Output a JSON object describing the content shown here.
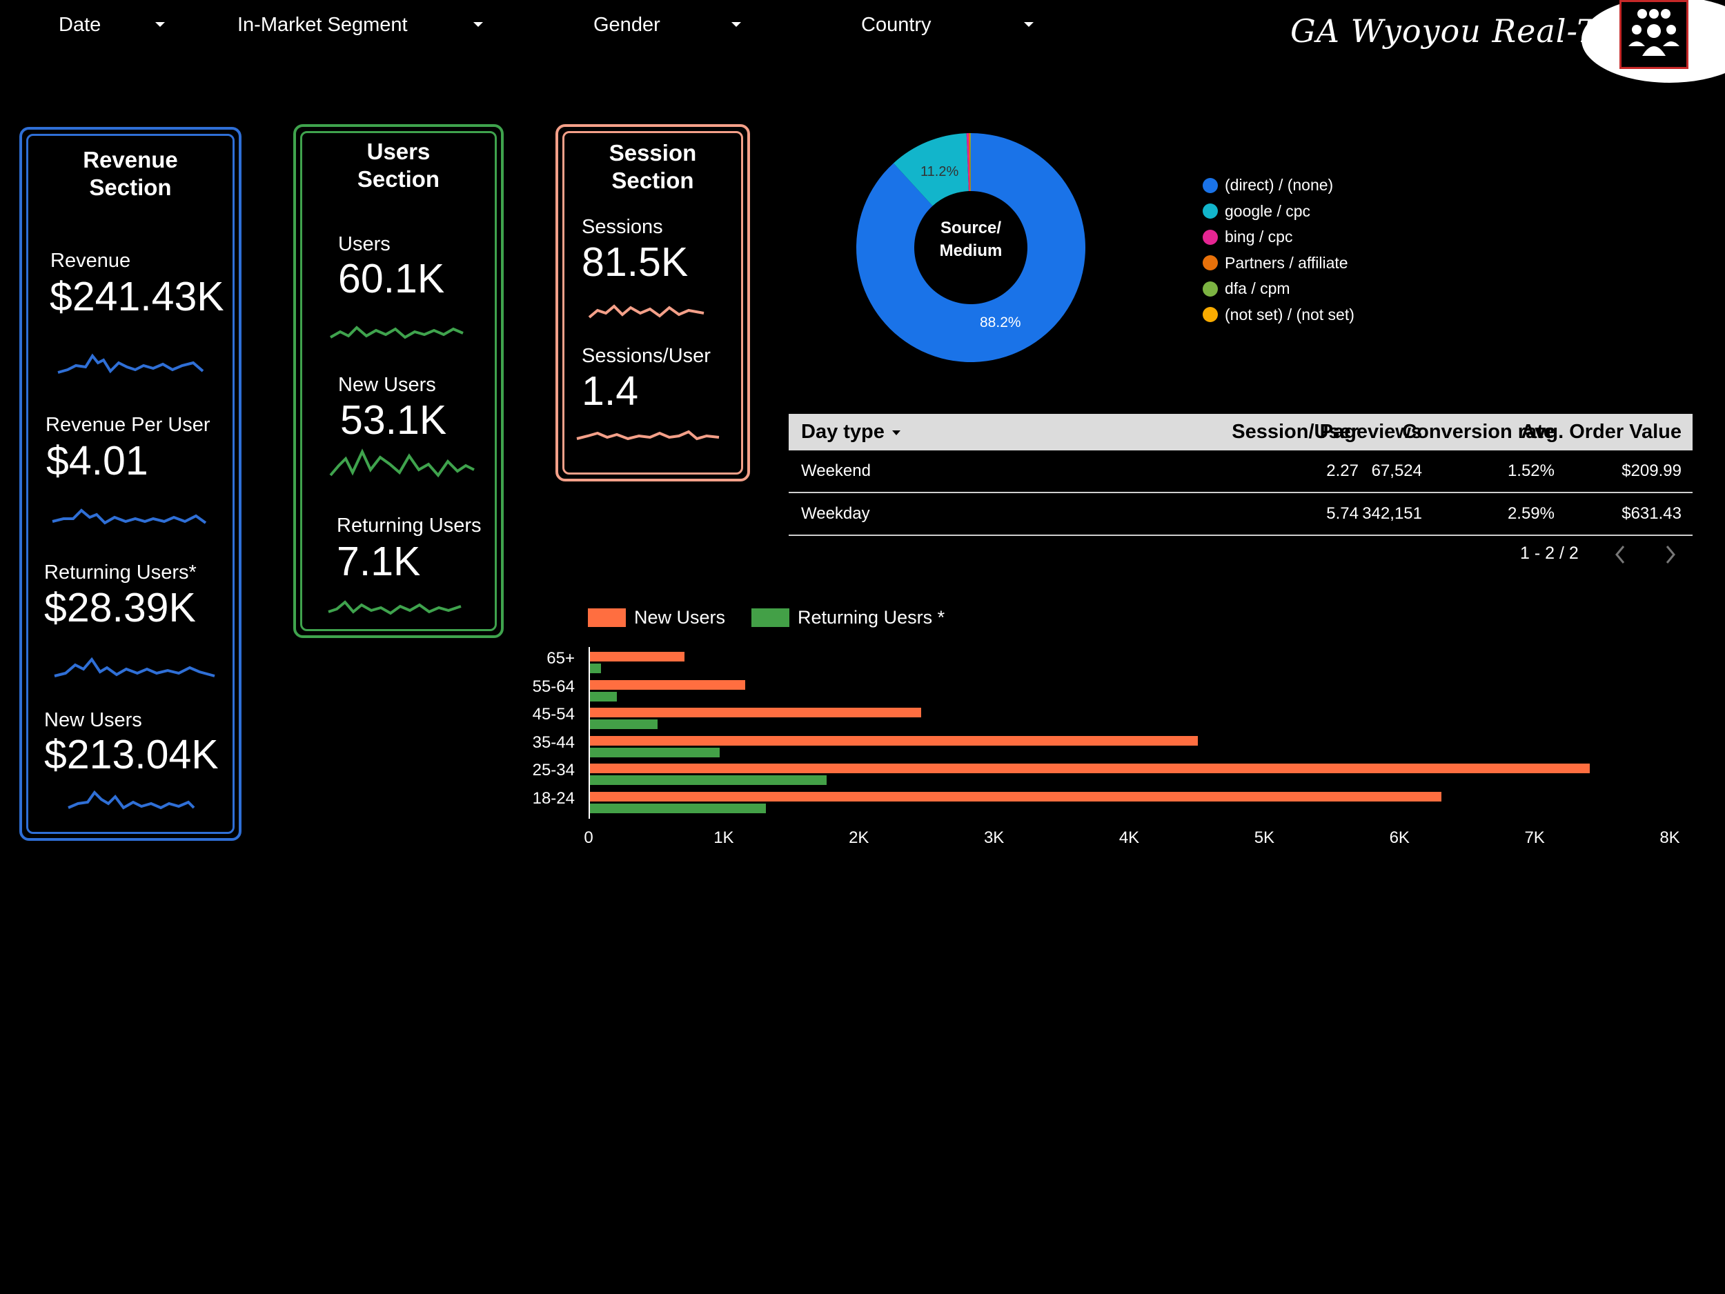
{
  "filters": [
    {
      "label": "Date"
    },
    {
      "label": "In-Market Segment"
    },
    {
      "label": "Gender"
    },
    {
      "label": "Country"
    }
  ],
  "header": {
    "title": "GA Wyoyou Real-Time",
    "logo_icon": "people-group-icon"
  },
  "revenue": {
    "title_line1": "Revenue",
    "title_line2": "Section",
    "color": "#2f6fd6",
    "metrics": [
      {
        "label": "Revenue",
        "value": "$241.43K"
      },
      {
        "label": "Revenue Per User",
        "value": "$4.01"
      },
      {
        "label": "Returning Users*",
        "value": "$28.39K"
      },
      {
        "label": "New Users",
        "value": "$213.04K"
      }
    ]
  },
  "users": {
    "title_line1": "Users",
    "title_line2": "Section",
    "color": "#3fa34d",
    "metrics": [
      {
        "label": "Users",
        "value": "60.1K"
      },
      {
        "label": "New Users",
        "value": "53.1K"
      },
      {
        "label": "Returning Users",
        "value": "7.1K"
      }
    ]
  },
  "sessions": {
    "title_line1": "Session",
    "title_line2": "Section",
    "color": "#f4a089",
    "metrics": [
      {
        "label": "Sessions",
        "value": "81.5K"
      },
      {
        "label": "Sessions/User",
        "value": "1.4"
      }
    ]
  },
  "donut": {
    "center_line1": "Source/",
    "center_line2": "Medium",
    "slices": [
      {
        "name": "(direct) / (none)",
        "value": 88.2,
        "label": "88.2%",
        "color": "#1a73e8"
      },
      {
        "name": "google / cpc",
        "value": 11.2,
        "label": "11.2%",
        "color": "#12b5cb"
      },
      {
        "name": "bing / cpc",
        "value": 0.3,
        "label": "",
        "color": "#e52592"
      },
      {
        "name": "Partners / affiliate",
        "value": 0.2,
        "label": "",
        "color": "#e8710a"
      },
      {
        "name": "dfa / cpm",
        "value": 0.1,
        "label": "",
        "color": "#7cb342"
      },
      {
        "name": "(not set) / (not set)",
        "value": 0.0,
        "label": "",
        "color": "#f9ab00"
      }
    ]
  },
  "table": {
    "headers": [
      "Day type",
      "Session/User",
      "Pageviews",
      "Conversion rate",
      "Avg. Order Value"
    ],
    "rows": [
      [
        "Weekend",
        "2.27",
        "67,524",
        "1.52%",
        "$209.99"
      ],
      [
        "Weekday",
        "5.74",
        "342,151",
        "2.59%",
        "$631.43"
      ]
    ],
    "pager": "1 - 2 / 2"
  },
  "chart_data": {
    "type": "bar",
    "orientation": "horizontal",
    "categories": [
      "65+",
      "55-64",
      "45-54",
      "35-44",
      "25-34",
      "18-24"
    ],
    "series": [
      {
        "name": "New Users",
        "color": "#ff6e40",
        "values": [
          700,
          1150,
          2450,
          4500,
          7400,
          6300
        ]
      },
      {
        "name": "Returning Uesrs *",
        "color": "#43a047",
        "values": [
          80,
          200,
          500,
          960,
          1750,
          1300
        ]
      }
    ],
    "xlim": [
      0,
      8000
    ],
    "xticks": [
      "0",
      "1K",
      "2K",
      "3K",
      "4K",
      "5K",
      "6K",
      "7K",
      "8K"
    ],
    "legend": "top-left",
    "grid": false
  }
}
